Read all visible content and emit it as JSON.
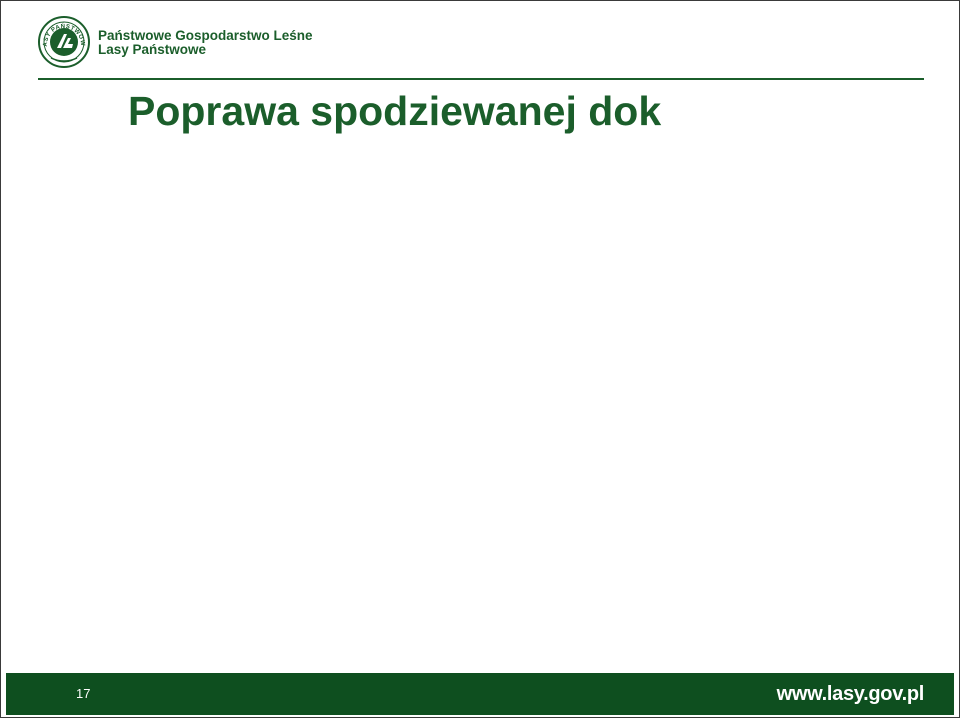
{
  "header": {
    "logo": {
      "icon": "lasy-panstwowe-emblem-icon",
      "ring_text": "LASY PAŃSTWOWE"
    },
    "org_line1": "Państwowe Gospodarstwo Leśne",
    "org_line2": "Lasy Państwowe",
    "accent_color": "#1b5e2b"
  },
  "slide": {
    "title": "Poprawa spodziewanej dok"
  },
  "footer": {
    "page_number": "17",
    "website": "www.lasy.gov.pl",
    "background_color": "#0e4f1f"
  }
}
